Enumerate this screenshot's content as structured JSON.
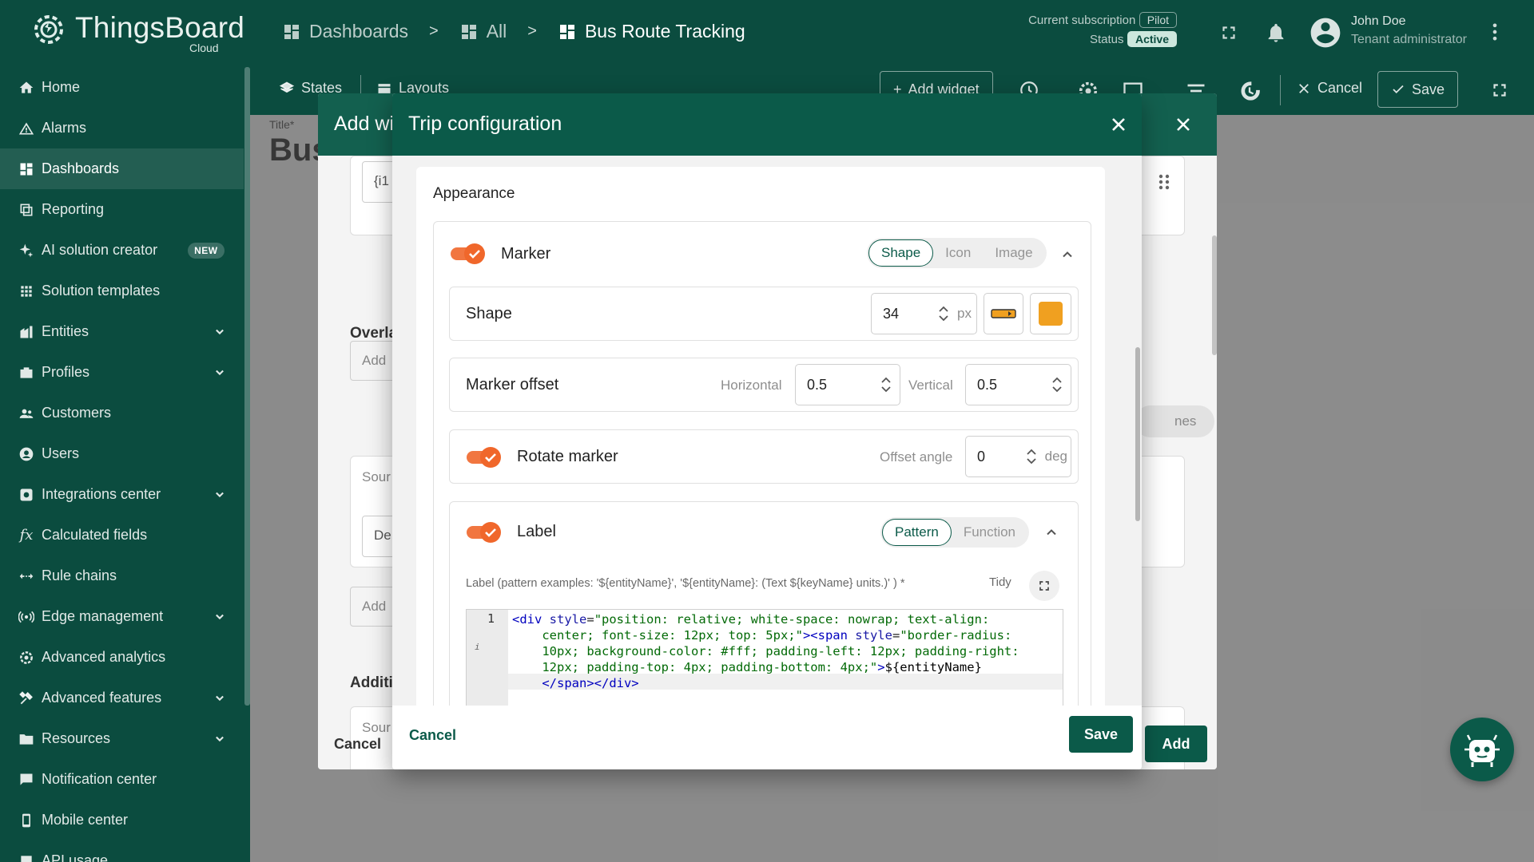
{
  "app": {
    "logo_text": "ThingsBoard",
    "logo_sub": "Cloud",
    "breadcrumbs": [
      "Dashboards",
      "All",
      "Bus Route Tracking"
    ],
    "subscription_label": "Current subscription",
    "subscription_value": "Pilot",
    "status_label": "Status",
    "status_value": "Active",
    "user_name": "John Doe",
    "user_role": "Tenant administrator"
  },
  "sidebar": {
    "items": [
      {
        "label": "Home",
        "icon": "home-icon"
      },
      {
        "label": "Alarms",
        "icon": "warning-icon"
      },
      {
        "label": "Dashboards",
        "icon": "dashboard-icon"
      },
      {
        "label": "Reporting",
        "icon": "report-icon"
      },
      {
        "label": "AI solution creator",
        "icon": "sparkle-icon",
        "badge": "NEW"
      },
      {
        "label": "Solution templates",
        "icon": "apps-icon"
      },
      {
        "label": "Entities",
        "icon": "entities-icon"
      },
      {
        "label": "Profiles",
        "icon": "profiles-icon"
      },
      {
        "label": "Customers",
        "icon": "customers-icon"
      },
      {
        "label": "Users",
        "icon": "user-icon"
      },
      {
        "label": "Integrations center",
        "icon": "integrations-icon"
      },
      {
        "label": "Calculated fields",
        "icon": "function-icon"
      },
      {
        "label": "Rule chains",
        "icon": "rule-chain-icon"
      },
      {
        "label": "Edge management",
        "icon": "edge-icon"
      },
      {
        "label": "Advanced analytics",
        "icon": "analytics-icon"
      },
      {
        "label": "Advanced features",
        "icon": "tools-icon"
      },
      {
        "label": "Resources",
        "icon": "folder-icon"
      },
      {
        "label": "Notification center",
        "icon": "notification-icon"
      },
      {
        "label": "Mobile center",
        "icon": "mobile-icon"
      },
      {
        "label": "API usage",
        "icon": "api-icon"
      }
    ],
    "selected": "Dashboards"
  },
  "dashboard_toolbar": {
    "states": "States",
    "layouts": "Layouts",
    "add_widget": "Add widget",
    "cancel": "Cancel",
    "save": "Save"
  },
  "background_page": {
    "title_label": "Title*",
    "title_value": "Bus"
  },
  "add_widget_dialog": {
    "title": "Add wi",
    "field_value": "{i1",
    "add_1": "Add",
    "overlays": "Overla",
    "source_1": "Sour",
    "field_de": "De",
    "add_2": "Add",
    "additional": "Additi",
    "source_2": "Sour",
    "chip_partial": "nes",
    "cancel": "Cancel",
    "add": "Add"
  },
  "trip_dialog": {
    "title": "Trip configuration",
    "section_title": "Appearance",
    "marker": {
      "label": "Marker",
      "enabled": true,
      "modes": [
        "Shape",
        "Icon",
        "Image"
      ],
      "selected_mode": "Shape"
    },
    "shape": {
      "label": "Shape",
      "size": "34",
      "unit": "px",
      "color": "#f0a020"
    },
    "marker_offset": {
      "label": "Marker offset",
      "horizontal_label": "Horizontal",
      "horizontal": "0.5",
      "vertical_label": "Vertical",
      "vertical": "0.5"
    },
    "rotate_marker": {
      "label": "Rotate marker",
      "enabled": true,
      "offset_angle_label": "Offset angle",
      "offset_angle": "0",
      "unit": "deg"
    },
    "label_section": {
      "label": "Label",
      "enabled": true,
      "modes": [
        "Pattern",
        "Function"
      ],
      "selected_mode": "Pattern",
      "field_label": "Label (pattern examples: '${entityName}', '${entityName}: (Text ${keyName} units.)' ) *",
      "tidy": "Tidy",
      "line_number": "1",
      "code_lines": [
        "<div style=\"position: relative; white-space: nowrap; text-align:",
        "    center; font-size: 12px; top: 5px;\"><span style=\"border-radius:",
        "    10px; background-color: #fff; padding-left: 12px; padding-right:",
        "    12px; padding-top: 4px; padding-bottom: 4px;\">${entityName}",
        "    </span></div>"
      ]
    },
    "cancel": "Cancel",
    "save": "Save"
  },
  "colors": {
    "primary": "#0b4c3f",
    "dialog_header": "#0b5a49",
    "toggle": "#f0672b",
    "marker_color": "#f0a020"
  }
}
